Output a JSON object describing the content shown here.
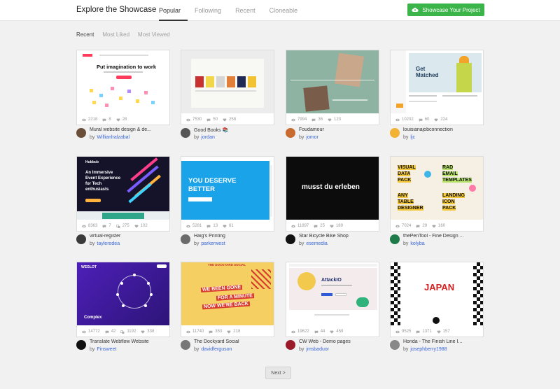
{
  "header": {
    "title": "Explore the Showcase",
    "tabs": [
      "Popular",
      "Following",
      "Recent",
      "Cloneable"
    ],
    "active_tab": "Popular",
    "showcase_button": "Showcase Your Project"
  },
  "filters": {
    "items": [
      "Recent",
      "Most Liked",
      "Most Viewed"
    ],
    "active": "Recent"
  },
  "cards": [
    {
      "title": "Mural website design & de...",
      "author": "Willianlralzabal",
      "views": "2218",
      "comments": "8",
      "likes": "28",
      "clones": ""
    },
    {
      "title": "Good Books 📚",
      "author": "jordan",
      "views": "7530",
      "comments": "50",
      "likes": "258",
      "clones": ""
    },
    {
      "title": "Foudamour",
      "author": "jomor",
      "views": "7994",
      "comments": "36",
      "likes": "123",
      "clones": ""
    },
    {
      "title": "louisianajobconnection",
      "author": "ljc",
      "views": "10202",
      "comments": "60",
      "likes": "224",
      "clones": ""
    },
    {
      "title": "virtual-register",
      "author": "taylerodea",
      "views": "8363",
      "comments": "7",
      "likes": "102",
      "clones": "275"
    },
    {
      "title": "Haig's Printing",
      "author": "parkerwest",
      "views": "5281",
      "comments": "13",
      "likes": "61",
      "clones": ""
    },
    {
      "title": "Star Bicycle Bike Shop",
      "author": "esemedia",
      "views": "11897",
      "comments": "25",
      "likes": "189",
      "clones": ""
    },
    {
      "title": "thePenTool - Fine Design ...",
      "author": "kolyba",
      "views": "7024",
      "comments": "29",
      "likes": "160",
      "clones": ""
    },
    {
      "title": "Translate Webflow Website",
      "author": "Finsweet",
      "views": "14772",
      "comments": "42",
      "likes": "338",
      "clones": "1192"
    },
    {
      "title": "The Dockyard Social",
      "author": "davidferguson",
      "views": "11740",
      "comments": "353",
      "likes": "218",
      "clones": ""
    },
    {
      "title": "CW Web - Demo pages",
      "author": "jmsbaduor",
      "views": "19622",
      "comments": "44",
      "likes": "459",
      "clones": ""
    },
    {
      "title": "Honda - The Finish Line I...",
      "author": "josephberry1988",
      "views": "9525",
      "comments": "1371",
      "likes": "157",
      "clones": ""
    }
  ],
  "thumbs": {
    "t1": {
      "heading": "Put imagination to work"
    },
    "t4": {
      "heading1": "Get",
      "heading2": "Matched"
    },
    "t5": {
      "line1": "An Immersive",
      "line2": "Event Experience",
      "line3": "for Tech",
      "line4": "enthusiasts",
      "brand": "Hubbub"
    },
    "t6": {
      "line1": "YOU DESERVE",
      "line2": "BETTER"
    },
    "t7": {
      "heading": "musst du erleben"
    },
    "t8": {
      "col1": [
        "VISUAL",
        "DATA",
        "PACK",
        "ANY",
        "TABLE",
        "DESIGNER"
      ],
      "col2": [
        "RAD",
        "EMAIL",
        "TEMPLATES",
        "LANDING",
        "ICON",
        "PACK"
      ]
    },
    "t9": {
      "brand": "WEGLOT",
      "word": "Complex"
    },
    "t10": {
      "brand": "THE DOCKYARD SOCIAL",
      "l1": "WE BEEN GONE",
      "l2": "FOR A MINUTE",
      "l3": "NOW WE'RE BACK"
    },
    "t11": {
      "heading": "AttackIO"
    },
    "t12": {
      "heading": "JAPAN"
    }
  },
  "pagination": {
    "next": "Next >"
  },
  "colors": {
    "accent_green": "#3bb54a",
    "link_blue": "#3a66d8",
    "background": "#f1f1f1"
  }
}
